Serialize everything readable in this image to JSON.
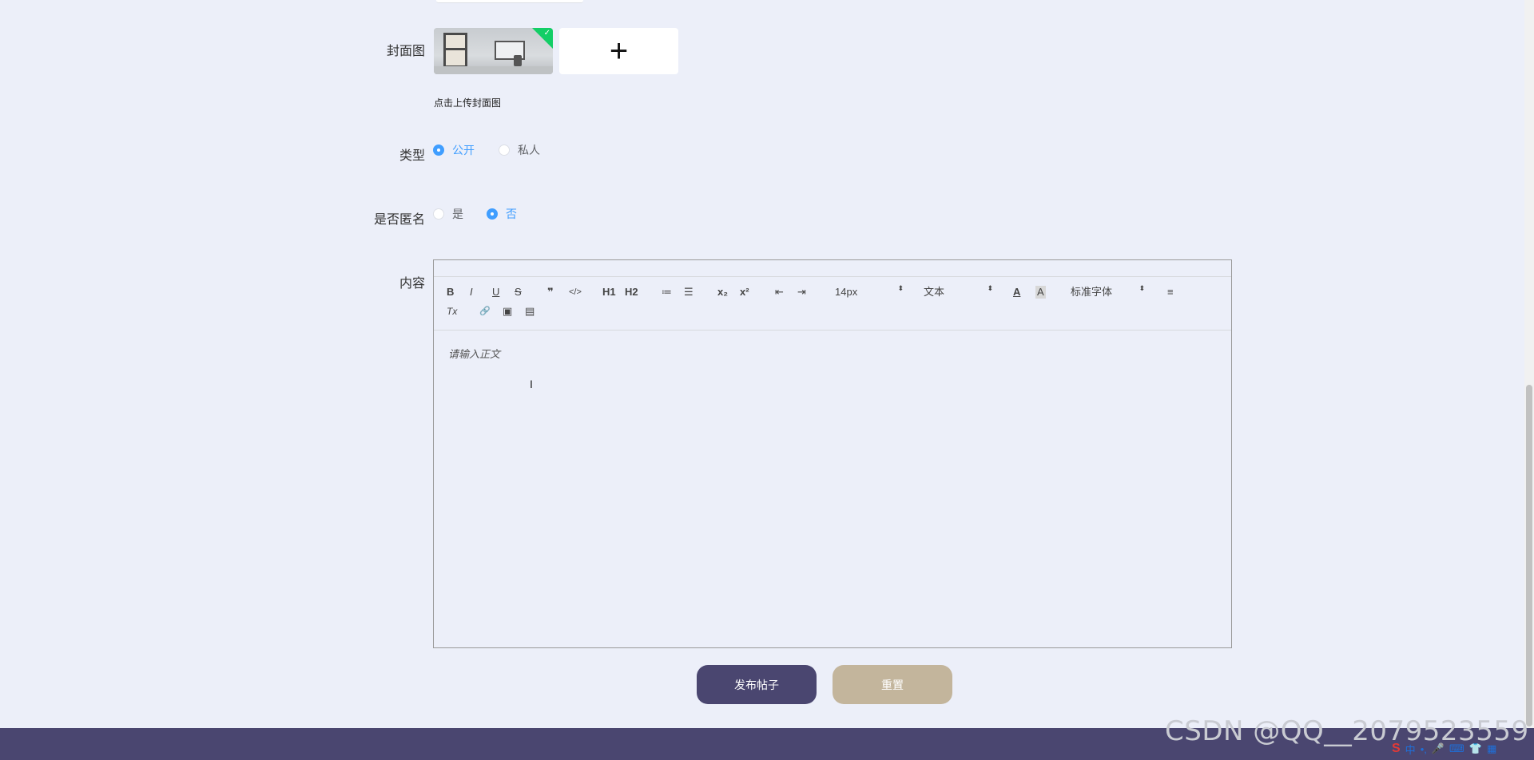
{
  "form": {
    "cover": {
      "label": "封面图",
      "upload_hint": "点击上传封面图",
      "plus_icon": "+",
      "badge_check": "✓"
    },
    "type": {
      "label": "类型",
      "options": [
        {
          "label": "公开",
          "checked": true
        },
        {
          "label": "私人",
          "checked": false
        }
      ]
    },
    "anonymous": {
      "label": "是否匿名",
      "options": [
        {
          "label": "是",
          "checked": false
        },
        {
          "label": "否",
          "checked": true
        }
      ]
    },
    "content": {
      "label": "内容",
      "placeholder": "请输入正文",
      "toolbar": {
        "bold": "B",
        "italic": "I",
        "underline": "U",
        "strike": "S",
        "blockquote": "❞",
        "code": "</>",
        "h1": "H1",
        "h2": "H2",
        "ordered_list": "≔",
        "bullet_list": "☰",
        "subscript": "x₂",
        "superscript": "x²",
        "outdent": "⇤",
        "indent": "⇥",
        "size_select": "14px",
        "header_select": "文本",
        "font_color": "A",
        "background_color": "A",
        "font_select": "标准字体",
        "align": "≡",
        "clean": "Tx",
        "link": "🔗",
        "image": "▣",
        "video": "▤",
        "select_arrow": "⬍"
      }
    }
  },
  "buttons": {
    "publish": "发布帖子",
    "reset": "重置"
  },
  "watermark": "CSDN @QQ__2079523559",
  "ime": {
    "logo": "S",
    "lang": "中",
    "punct": "•,",
    "items": [
      "🎤",
      "⌨",
      "👕",
      "▦"
    ]
  },
  "colors": {
    "primary": "#409eff",
    "publish_button": "#4a4670",
    "reset_button": "#c3b59c",
    "footer": "#4a4670",
    "background": "#eceff9"
  }
}
